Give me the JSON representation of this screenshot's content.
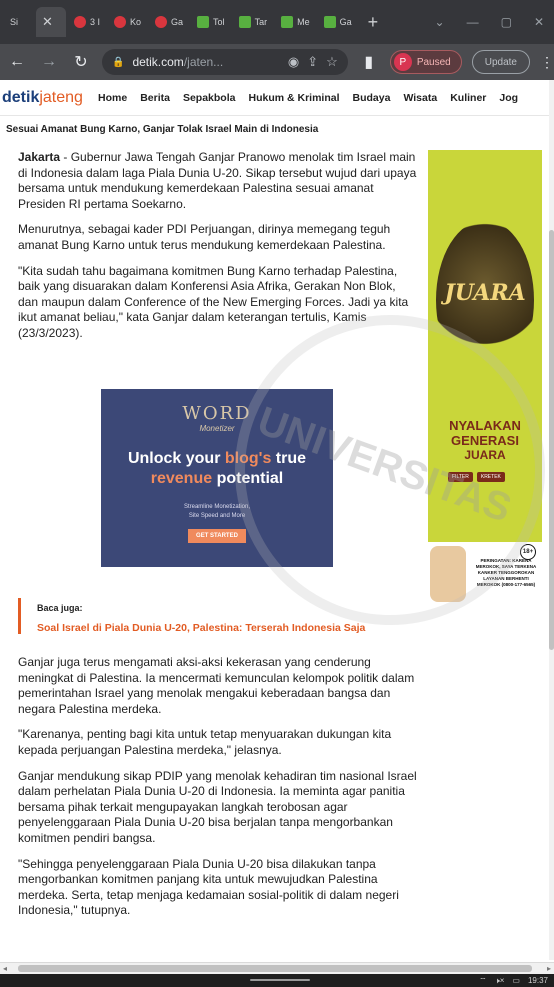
{
  "browser": {
    "tabs": [
      {
        "label": "Si",
        "favicon": "globe",
        "active": false
      },
      {
        "label": "",
        "favicon": "close",
        "active": true
      },
      {
        "label": "3 I",
        "favicon": "detik-red",
        "active": false
      },
      {
        "label": "Ko",
        "favicon": "detik-red",
        "active": false
      },
      {
        "label": "Ga",
        "favicon": "detik-red",
        "active": false
      },
      {
        "label": "Tol",
        "favicon": "green-square",
        "active": false
      },
      {
        "label": "Tar",
        "favicon": "green-square",
        "active": false
      },
      {
        "label": "Me",
        "favicon": "green-square",
        "active": false
      },
      {
        "label": "Ga",
        "favicon": "green-square",
        "active": false
      }
    ],
    "new_tab": "+",
    "window_controls": [
      "⌄",
      "—",
      "▢",
      "✕"
    ],
    "url_domain": "detik.com",
    "url_path": "/jaten...",
    "profile_initial": "P",
    "profile_status": "Paused",
    "update_label": "Update"
  },
  "site": {
    "logo_part1": "detik",
    "logo_part2": "jateng",
    "nav": [
      "Home",
      "Berita",
      "Sepakbola",
      "Hukum & Kriminal",
      "Budaya",
      "Wisata",
      "Kuliner",
      "Jog"
    ]
  },
  "article": {
    "headline": "Sesuai Amanat Bung Karno, Ganjar Tolak Israel Main di Indonesia",
    "lead_place": "Jakarta",
    "lead_text": " - Gubernur Jawa Tengah Ganjar Pranowo menolak tim Israel main di Indonesia dalam laga Piala Dunia U-20. Sikap tersebut wujud dari upaya bersama untuk mendukung kemerdekaan Palestina sesuai amanat Presiden RI pertama Soekarno.",
    "p2": "Menurutnya, sebagai kader PDI Perjuangan, dirinya memegang teguh amanat Bung Karno untuk terus mendukung kemerdekaan Palestina.",
    "p3": "\"Kita sudah tahu bagaimana komitmen Bung Karno terhadap Palestina, baik yang disuarakan dalam Konferensi Asia Afrika, Gerakan Non Blok, dan maupun dalam Conference of the New Emerging Forces. Jadi ya kita ikut amanat beliau,\" kata Ganjar dalam keterangan tertulis, Kamis (23/3/2023).",
    "baca_label": "Baca juga:",
    "baca_link": "Soal Israel di Piala Dunia U-20, Palestina: Terserah Indonesia Saja",
    "p4": "Ganjar juga terus mengamati aksi-aksi kekerasan yang cenderung meningkat di Palestina. Ia mencermati kemunculan kelompok politik dalam pemerintahan Israel yang menolak mengakui keberadaan bangsa dan negara Palestina merdeka.",
    "p5": "\"Karenanya, penting bagi kita untuk tetap menyuarakan dukungan kita kepada perjuangan Palestina merdeka,\" jelasnya.",
    "p6": "Ganjar mendukung sikap PDIP yang menolak kehadiran tim nasional Israel dalam perhelatan Piala Dunia U-20 di Indonesia. Ia meminta agar panitia bersama pihak terkait mengupayakan langkah terobosan agar penyelenggaraan Piala Dunia U-20 bisa berjalan tanpa mengorbankan komitmen pendiri bangsa.",
    "p7": "\"Sehingga penyelenggaraan Piala Dunia U-20 bisa dilakukan tanpa mengorbankan komitmen panjang kita untuk mewujudkan Palestina merdeka. Serta, tetap menjaga kedamaian sosial-politik di dalam negeri Indonesia,\" tutupnya."
  },
  "ad_inline": {
    "brand": "WORD",
    "brand_sub": "Monetizer",
    "headline_1": "Unlock your ",
    "headline_hl": "blog's",
    "headline_2": " true",
    "headline_3a": "revenue ",
    "headline_3b": "potential",
    "sub_1": "Streamline Monetization,",
    "sub_2": "Site Speed and More",
    "cta": "GET STARTED"
  },
  "ad_side": {
    "brand": "JUARA",
    "tagline_1": "NYALAKAN",
    "tagline_2": "GENERASI",
    "tagline_3": "JUARA",
    "flavor_1": "FILTER",
    "flavor_2": "KRETEK",
    "age": "18+",
    "warning": "PERINGATAN: KARENA MEROKOK, SAYA TERKENA KANKER TENGGOROKAN LAYANAN BERHENTI MEROKOK (0800-177-6565)"
  },
  "watermark_text": "UNIVERSITAS",
  "taskbar": {
    "time": "19:37"
  },
  "colors": {
    "accent": "#e25c24",
    "logo_blue": "#1c3f7a",
    "ad_bg": "#3c4877",
    "side_ad_bg": "#c9d63a"
  }
}
